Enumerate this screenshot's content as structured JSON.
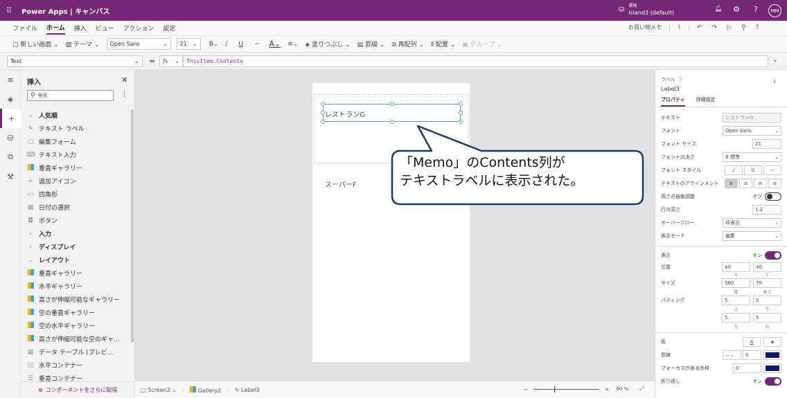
{
  "app": {
    "title": "Power Apps | キャンバス",
    "env_label": "環境",
    "env_name": "island3 (default)",
    "avatar": "MM"
  },
  "menu": [
    "ファイル",
    "ホーム",
    "挿入",
    "ビュー",
    "アクション",
    "設定"
  ],
  "menu_right": {
    "app_name": "お買い物メモ"
  },
  "toolbar": {
    "new_screen": "新しい画面",
    "theme": "テーマ",
    "font": "Open Sans",
    "size": "21",
    "bold": "B",
    "italic": "/",
    "underline": "U",
    "fill": "塗りつぶし",
    "border": "罫線",
    "reorder": "再配列",
    "align": "配置",
    "group": "グループ"
  },
  "formula": {
    "property": "Text",
    "fx": "fx",
    "expression": "ThisItem.Contents"
  },
  "insert_panel": {
    "title": "挿入",
    "search_placeholder": "検索",
    "items": [
      {
        "label": "人気順",
        "type": "head",
        "icon": "v"
      },
      {
        "label": "テキスト ラベル",
        "icon": "✎"
      },
      {
        "label": "編集フォーム",
        "icon": "▢"
      },
      {
        "label": "テキスト入力",
        "icon": "⌨"
      },
      {
        "label": "垂直ギャラリー",
        "icon": "gal"
      },
      {
        "label": "追加アイコン",
        "icon": "+"
      },
      {
        "label": "四角形",
        "icon": "▭"
      },
      {
        "label": "日付の選択",
        "icon": "▦"
      },
      {
        "label": "ボタン",
        "icon": "◘"
      },
      {
        "label": "入力",
        "type": "head",
        "icon": ">"
      },
      {
        "label": "ディスプレイ",
        "type": "head",
        "icon": ">"
      },
      {
        "label": "レイアウト",
        "type": "head",
        "icon": "v"
      },
      {
        "label": "垂直ギャラリー",
        "icon": "gal"
      },
      {
        "label": "水平ギャラリー",
        "icon": "gal"
      },
      {
        "label": "高さが伸縮可能なギャラリー",
        "icon": "gal"
      },
      {
        "label": "空の垂直ギャラリー",
        "icon": "gal"
      },
      {
        "label": "空の水平ギャラリー",
        "icon": "gal"
      },
      {
        "label": "高さが伸縮可能な空のギャ...",
        "icon": "gal"
      },
      {
        "label": "データ テーブル (プレビ...",
        "icon": "▦"
      },
      {
        "label": "水平コンテナー",
        "icon": "▯▯"
      },
      {
        "label": "垂直コンテナー",
        "icon": "☰"
      }
    ],
    "footer": "コンポーネントをさらに取得"
  },
  "canvas": {
    "label_text": "レストランG",
    "second_item": "スーパーF"
  },
  "callout": {
    "line1": "「Memo」のContents列が",
    "line2": "テキストラベルに表示された。"
  },
  "status": {
    "screen": "Screen2",
    "gallery": "Gallery2",
    "label": "Label3",
    "zoom": "60 %"
  },
  "props": {
    "type": "ラベル",
    "name": "Label3",
    "tabs": [
      "プロパティ",
      "詳細設定"
    ],
    "text_label": "テキスト",
    "text_value": "レストランG",
    "font_label": "フォント",
    "font_value": "Open Sans",
    "size_label": "フォント サイズ",
    "size_value": "21",
    "weight_label": "フォントの太さ",
    "weight_value": "B 標準",
    "style_label": "フォント スタイル",
    "align_label": "テキストのアラインメント",
    "autoheight_label": "高さの自動調整",
    "autoheight_value": "オフ",
    "lineheight_label": "行の高さ",
    "lineheight_value": "1.2",
    "overflow_label": "オーバーフロー",
    "overflow_value": "非表示",
    "mode_label": "表示モード",
    "mode_value": "編集",
    "visible_label": "表示",
    "visible_value": "オン",
    "position_label": "位置",
    "x": "40",
    "y": "40",
    "x_label": "X",
    "y_label": "Y",
    "size2_label": "サイズ",
    "width": "560",
    "height": "70",
    "w_label": "幅",
    "h_label": "高さ",
    "padding_label": "パディング",
    "pt": "5",
    "pb": "5",
    "pl": "5",
    "pr": "5",
    "pt_label": "上",
    "pb_label": "下",
    "pl_label": "左",
    "pr_label": "右",
    "color_label": "色",
    "border_label": "罫線",
    "border_value": "0",
    "focus_label": "フォーカスがある外枠",
    "focus_value": "0",
    "wrap_label": "折り返し",
    "wrap_value": "オン",
    "navy": "#0b1a6b"
  }
}
